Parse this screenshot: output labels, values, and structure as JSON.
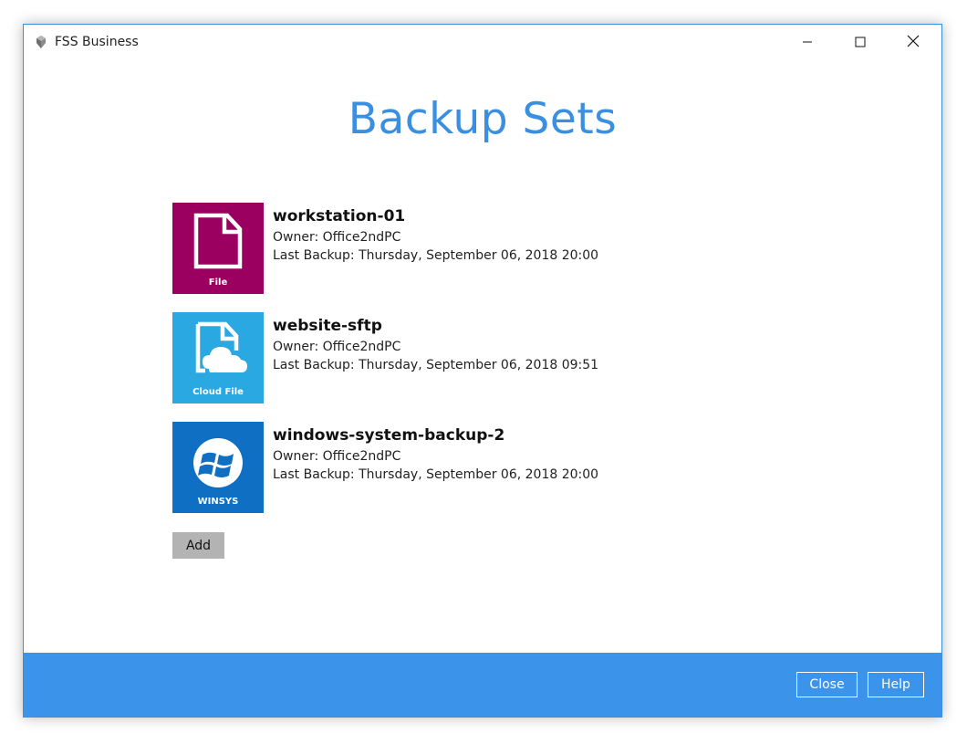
{
  "window": {
    "title": "FSS Business",
    "app_icon": "fss-app-icon"
  },
  "window_controls": {
    "minimize_icon": "minimize-icon",
    "maximize_icon": "maximize-icon",
    "close_icon": "close-icon"
  },
  "page": {
    "title": "Backup Sets"
  },
  "backup_sets": [
    {
      "name": "workstation-01",
      "owner": "Owner: Office2ndPC",
      "last_backup": "Last Backup: Thursday, September 06, 2018 20:00",
      "type_label": "File",
      "icon": "file-icon",
      "color": "#9b0060"
    },
    {
      "name": "website-sftp",
      "owner": "Owner: Office2ndPC",
      "last_backup": "Last Backup: Thursday, September 06, 2018 09:51",
      "type_label": "Cloud File",
      "icon": "cloud-file-icon",
      "color": "#2aa8e2"
    },
    {
      "name": "windows-system-backup-2",
      "owner": "Owner: Office2ndPC",
      "last_backup": "Last Backup: Thursday, September 06, 2018 20:00",
      "type_label": "WINSYS",
      "icon": "windows-icon",
      "color": "#0f6fc2"
    }
  ],
  "actions": {
    "add_label": "Add"
  },
  "footer": {
    "close_label": "Close",
    "help_label": "Help",
    "bar_color": "#3c94ea"
  },
  "colors": {
    "accent": "#3a8fe0",
    "window_border": "#3c8fdc"
  }
}
